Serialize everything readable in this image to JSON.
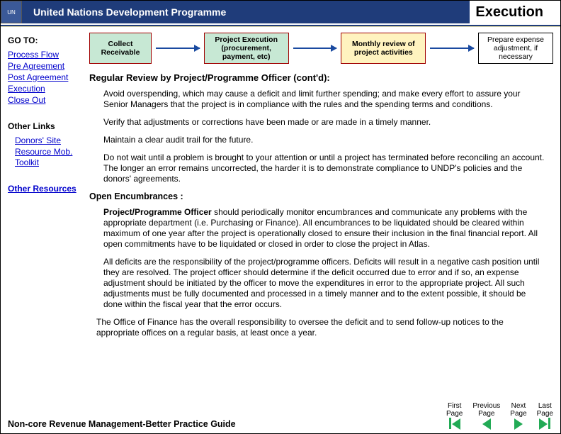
{
  "header": {
    "org_name": "United Nations Development Programme",
    "page_title": "Execution"
  },
  "sidebar": {
    "goto_heading": "GO TO:",
    "goto_links": [
      "Process Flow",
      "Pre Agreement",
      "Post Agreement",
      "Execution",
      "Close Out"
    ],
    "other_links_heading": "Other Links",
    "other_links": [
      "Donors' Site",
      "Resource Mob. Toolkit"
    ],
    "other_resources_heading": "Other Resources"
  },
  "flow": {
    "box1": "Collect Receivable",
    "box2": "Project Execution (procurement, payment, etc)",
    "box3": "Monthly review of project activities",
    "box4": "Prepare expense adjustment, if necessary"
  },
  "content": {
    "review_heading": "Regular Review by Project/Programme Officer (cont'd):",
    "p1": "Avoid overspending, which may cause a deficit and limit further spending; and make every effort to assure your Senior Managers that the project is in compliance with the rules and the spending terms and conditions.",
    "p2": "Verify that adjustments or corrections have been made or are made in a timely manner.",
    "p3": "Maintain a clear audit trail for the future.",
    "p4": "Do not wait until a problem is brought to your attention or until a project has terminated before reconciling an account. The longer an error remains uncorrected, the harder it is to demonstrate compliance to UNDP's policies and the donors' agreements.",
    "encumbr_heading": "Open Encumbrances :",
    "p5a": "Project/Programme Officer ",
    "p5b": "should periodically monitor encumbrances and communicate any problems with the appropriate department (i.e. Purchasing or Finance). All encumbrances to be liquidated should be cleared within maximum of one year after the project is operationally closed to ensure their inclusion in the final financial report. All open commitments have to be liquidated or closed in order to close the project in Atlas.",
    "p6": "All deficits are the responsibility of the project/programme officers. Deficits will result in a negative cash position until they are resolved. The project officer should determine if the deficit occurred due to error and if so, an expense adjustment should be initiated by the officer to move the expenditures in error to the appropriate project. All such adjustments must be fully documented and processed in a timely manner and to the extent possible, it should be done within the fiscal year that the error occurs.",
    "p7": "The Office of Finance has the overall responsibility to oversee the deficit and to send follow-up notices to the appropriate offices on a regular basis, at least once a year."
  },
  "footer": {
    "doc_title": "Non-core Revenue Management-Better Practice Guide",
    "nav": {
      "first": "First Page",
      "prev": "Previous Page",
      "next": "Next Page",
      "last": "Last Page"
    }
  }
}
